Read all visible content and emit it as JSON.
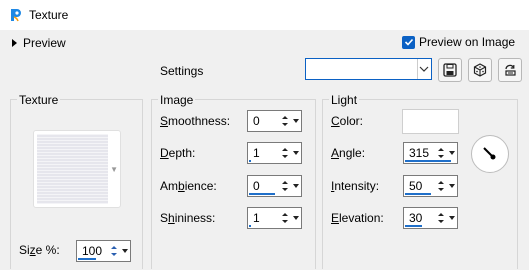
{
  "window": {
    "title": "Texture"
  },
  "preview": {
    "label": "Preview",
    "on_image_label": "Preview on Image",
    "on_image_checked": true
  },
  "settings": {
    "label": "Settings",
    "value": ""
  },
  "icons": {
    "save": "save-icon",
    "cube": "cube-icon",
    "reset": "reset-icon",
    "app": "paintshop-icon",
    "dial": "angle-dial-icon"
  },
  "texture_group": {
    "title": "Texture",
    "size": {
      "label_pre": "Si",
      "label_u": "z",
      "label_post": "e %:",
      "value": "100"
    }
  },
  "image_group": {
    "title": "Image",
    "smoothness": {
      "label_u": "S",
      "label_rest": "moothness:",
      "value": "0",
      "fill": 0
    },
    "depth": {
      "label_u": "D",
      "label_rest": "epth:",
      "value": "1",
      "fill": 0.02
    },
    "ambience": {
      "label_pre": "Am",
      "label_u": "b",
      "label_rest": "ience:",
      "value": "0",
      "fill": 0.5
    },
    "shininess": {
      "label_pre": "S",
      "label_u": "h",
      "label_rest": "ininess:",
      "value": "1",
      "fill": 0.02
    }
  },
  "light_group": {
    "title": "Light",
    "color": {
      "label_u": "C",
      "label_rest": "olor:",
      "value": "#ffffff"
    },
    "angle": {
      "label_u": "A",
      "label_rest": "ngle:",
      "value": "315",
      "fill": 0.87
    },
    "intensity": {
      "label_u": "I",
      "label_rest": "ntensity:",
      "value": "50",
      "fill": 0.5
    },
    "elevation": {
      "label_u": "E",
      "label_rest": "levation:",
      "value": "30",
      "fill": 0.33
    }
  },
  "colors": {
    "accent": "#0b61c4",
    "bar": "#1f6fc9"
  }
}
